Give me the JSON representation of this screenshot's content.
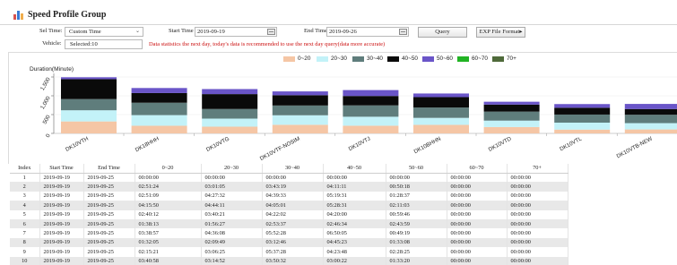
{
  "app": {
    "title": "Speed Profile Group"
  },
  "filters": {
    "sel_time_label": "Sel Time:",
    "sel_time_value": "Custom Time",
    "start_time_label": "Start Time",
    "start_time_value": "2019-09-19",
    "end_time_label": "End Time",
    "end_time_value": "2019-09-26",
    "query_label": "Query",
    "export_label": "EXP File Format▸",
    "vehicle_label": "Vehicle:",
    "vehicle_value": "Selected:10",
    "notice": "Data statistics the next day, today's data is recommended to use the next day query(data more accurate)"
  },
  "colors": {
    "s0_20": "#f5c6a5",
    "s20_30": "#c3f2f8",
    "s30_40": "#5f7d7c",
    "s40_50": "#0a0a0a",
    "s50_60": "#6a55c8",
    "s60_70": "#22b324",
    "s70_plus": "#4f6a3a"
  },
  "chart_data": {
    "type": "bar",
    "stacked": true,
    "ylabel": "Duration(Minute)",
    "ylim": [
      0,
      1500
    ],
    "yticks": [
      "0",
      "500",
      "1,000",
      "1,500"
    ],
    "legend_position": "top-right",
    "categories": [
      "DK10VTH",
      "DK18HHH",
      "DK10VTG",
      "DK10VTF-NOSIM",
      "DK10VTJ",
      "DK10BHHN",
      "DK10VTD",
      "DK10VTL",
      "DK10VTB-NEW",
      "DK10VTE"
    ],
    "series": [
      {
        "name": "0~20",
        "color": "#f5c6a5",
        "values": [
          318,
          203,
          179,
          229,
          204,
          227,
          170,
          101,
          105,
          100
        ]
      },
      {
        "name": "20~30",
        "color": "#c3f2f8",
        "values": [
          297,
          283,
          214,
          253,
          239,
          186,
          170,
          185,
          168,
          150
        ]
      },
      {
        "name": "30~40",
        "color": "#5f7d7c",
        "values": [
          298,
          330,
          256,
          260,
          302,
          276,
          240,
          215,
          223,
          200
        ]
      },
      {
        "name": "40~50",
        "color": "#0a0a0a",
        "values": [
          529,
          257,
          396,
          274,
          250,
          276,
          186,
          181,
          152,
          150
        ]
      },
      {
        "name": "50~60",
        "color": "#6a55c8",
        "values": [
          51,
          134,
          134,
          101,
          157,
          96,
          76,
          98,
          136,
          80
        ]
      },
      {
        "name": "60~70",
        "color": "#22b324",
        "values": [
          0,
          0,
          0,
          0,
          0,
          0,
          0,
          0,
          0,
          0
        ]
      },
      {
        "name": "70+",
        "color": "#4f6a3a",
        "values": [
          0,
          0,
          0,
          0,
          0,
          0,
          0,
          0,
          0,
          0
        ]
      }
    ]
  },
  "table": {
    "columns": [
      "Index",
      "Start Time",
      "End Time",
      "0~20",
      "20~30",
      "30~40",
      "40~50",
      "50~60",
      "60~70",
      "70+"
    ],
    "rows": [
      [
        "1",
        "2019-09-19",
        "2019-09-25",
        "00:00:00",
        "00:00:00",
        "00:00:00",
        "00:00:00",
        "00:00:00",
        "00:00:00",
        "00:00:00"
      ],
      [
        "2",
        "2019-09-19",
        "2019-09-25",
        "02:51:24",
        "03:01:05",
        "03:43:19",
        "04:11:11",
        "00:50:18",
        "00:00:00",
        "00:00:00"
      ],
      [
        "3",
        "2019-09-19",
        "2019-09-25",
        "02:51:09",
        "04:27:32",
        "04:39:33",
        "05:19:31",
        "01:28:37",
        "00:00:00",
        "00:00:00"
      ],
      [
        "4",
        "2019-09-19",
        "2019-09-25",
        "04:15:50",
        "04:44:11",
        "04:05:01",
        "05:28:31",
        "02:11:03",
        "00:00:00",
        "00:00:00"
      ],
      [
        "5",
        "2019-09-19",
        "2019-09-25",
        "02:40:12",
        "03:40:21",
        "04:22:02",
        "04:20:00",
        "00:59:46",
        "00:00:00",
        "00:00:00"
      ],
      [
        "6",
        "2019-09-19",
        "2019-09-25",
        "01:38:13",
        "01:56:27",
        "02:53:37",
        "02:46:34",
        "02:43:59",
        "00:00:00",
        "00:00:00"
      ],
      [
        "7",
        "2019-09-19",
        "2019-09-25",
        "03:38:57",
        "04:36:08",
        "05:52:28",
        "06:50:05",
        "00:49:19",
        "00:00:00",
        "00:00:00"
      ],
      [
        "8",
        "2019-09-19",
        "2019-09-25",
        "01:32:05",
        "02:09:49",
        "03:12:46",
        "04:45:23",
        "01:33:08",
        "00:00:00",
        "00:00:00"
      ],
      [
        "9",
        "2019-09-19",
        "2019-09-25",
        "02:15:21",
        "03:06:25",
        "05:37:28",
        "04:23:48",
        "02:28:25",
        "00:00:00",
        "00:00:00"
      ],
      [
        "10",
        "2019-09-19",
        "2019-09-25",
        "03:40:58",
        "03:14:52",
        "03:50:32",
        "03:00:22",
        "01:33:20",
        "00:00:00",
        "00:00:00"
      ]
    ]
  }
}
